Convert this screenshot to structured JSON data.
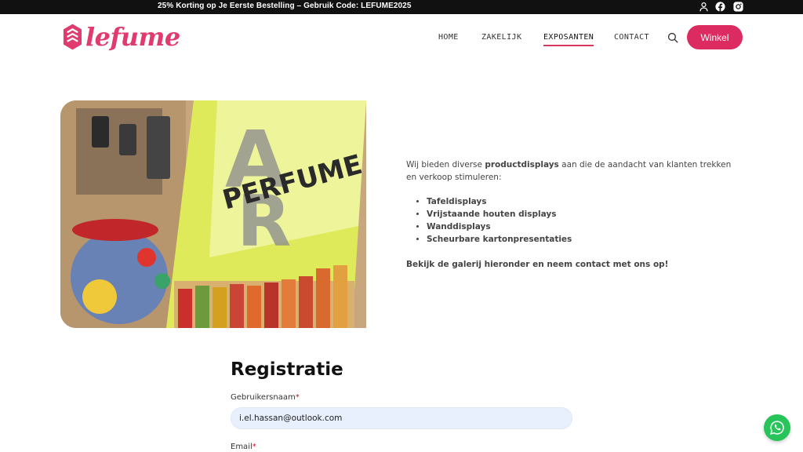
{
  "topbar": {
    "promo": "25% Korting op Je Eerste Bestelling – Gebruik Code: LEFUME2025",
    "icons": [
      "user-icon",
      "facebook-icon",
      "instagram-icon"
    ]
  },
  "header": {
    "logo_text": "lefume",
    "nav": [
      {
        "label": "HOME"
      },
      {
        "label": "ZAKELIJK"
      },
      {
        "label": "EXPOSANTEN",
        "active": true
      },
      {
        "label": "CONTACT"
      }
    ],
    "search_icon": "search-icon",
    "shop_button": "Winkel"
  },
  "hero": {
    "image_text": "PERFUME"
  },
  "content": {
    "intro_before": "Wij bieden diverse ",
    "intro_bold": "productdisplays",
    "intro_after": " aan die de aandacht van klanten trekken en verkoop stimuleren:",
    "list": [
      "Tafeldisplays",
      "Vrijstaande houten displays",
      "Wanddisplays",
      "Scheurbare kartonpresentaties"
    ],
    "cta": "Bekijk de galerij hieronder en neem contact met ons op!"
  },
  "registration": {
    "title": "Registratie",
    "username_label": "Gebruikersnaam",
    "username_value": "i.el.hassan@outlook.com",
    "email_label": "Email",
    "required_mark": "*"
  },
  "colors": {
    "brand": "#db2b60",
    "topbar": "#111111",
    "whatsapp": "#27c45a"
  }
}
